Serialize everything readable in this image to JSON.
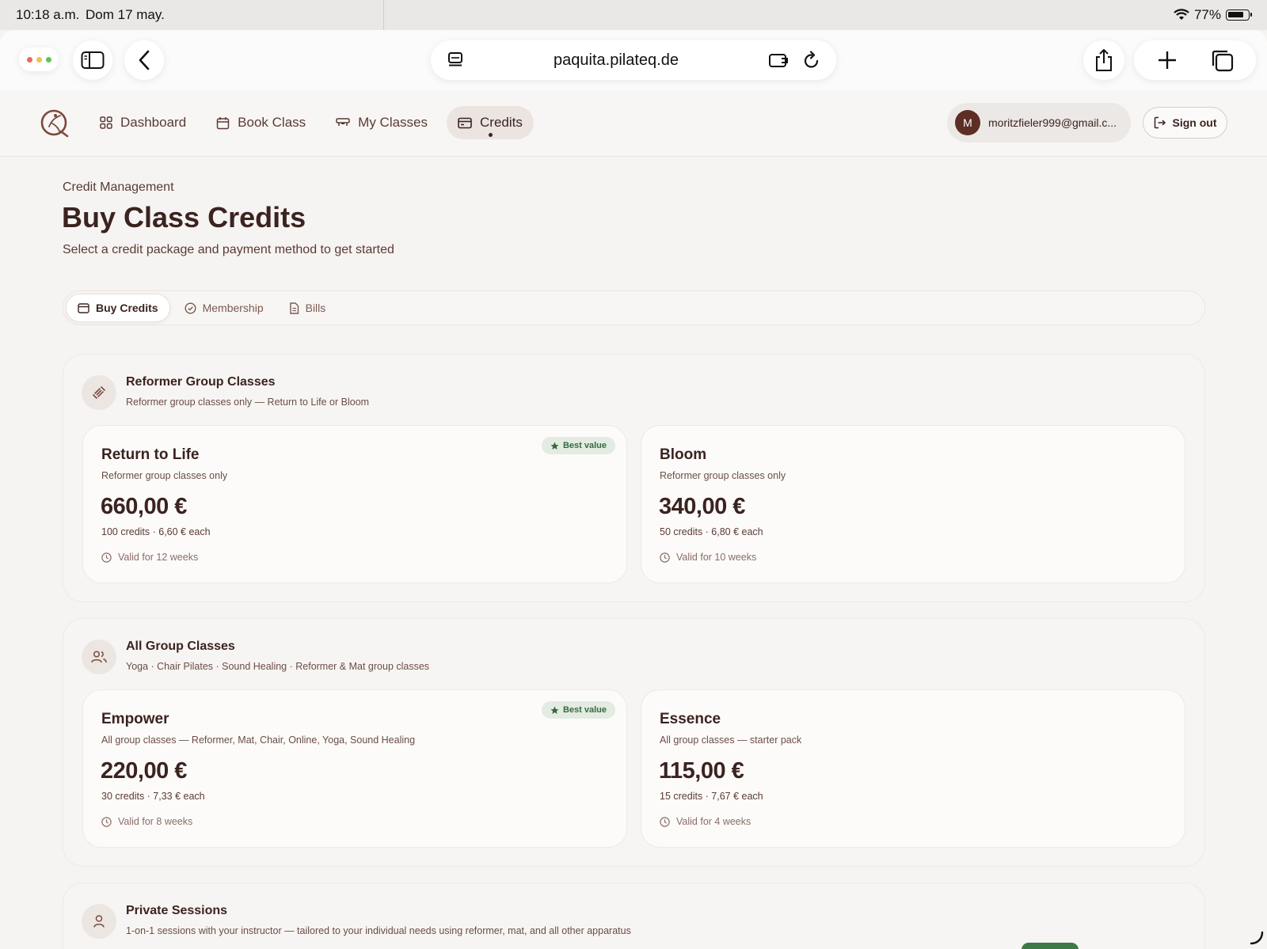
{
  "status_bar": {
    "time": "10:18 a.m.",
    "date": "Dom 17 may.",
    "battery": "77%"
  },
  "browser": {
    "url": "paquita.pilateq.de"
  },
  "nav": {
    "items": [
      {
        "label": "Dashboard",
        "icon": "grid-icon"
      },
      {
        "label": "Book Class",
        "icon": "calendar-icon"
      },
      {
        "label": "My Classes",
        "icon": "reformer-icon"
      },
      {
        "label": "Credits",
        "icon": "card-icon",
        "active": true
      }
    ],
    "user_initial": "M",
    "user_email": "moritzfieler999@gmail.c...",
    "signout_label": "Sign out"
  },
  "page": {
    "eyebrow": "Credit Management",
    "title": "Buy Class Credits",
    "subtitle": "Select a credit package and payment method to get started"
  },
  "tabs": [
    {
      "label": "Buy Credits",
      "active": true
    },
    {
      "label": "Membership"
    },
    {
      "label": "Bills"
    }
  ],
  "sections": [
    {
      "title": "Reformer Group Classes",
      "description": "Reformer group classes only — Return to Life or Bloom",
      "packages": [
        {
          "name": "Return to Life",
          "description": "Reformer group classes only",
          "price": "660,00 €",
          "credits": "100 credits · 6,60 € each",
          "validity": "Valid for 12 weeks",
          "badge": "Best value"
        },
        {
          "name": "Bloom",
          "description": "Reformer group classes only",
          "price": "340,00 €",
          "credits": "50 credits · 6,80 € each",
          "validity": "Valid for 10 weeks"
        }
      ]
    },
    {
      "title": "All Group Classes",
      "description": "Yoga · Chair Pilates · Sound Healing · Reformer & Mat group classes",
      "packages": [
        {
          "name": "Empower",
          "description": "All group classes — Reformer, Mat, Chair, Online, Yoga, Sound Healing",
          "price": "220,00 €",
          "credits": "30 credits · 7,33 € each",
          "validity": "Valid for 8 weeks",
          "badge": "Best value"
        },
        {
          "name": "Essence",
          "description": "All group classes — starter pack",
          "price": "115,00 €",
          "credits": "15 credits · 7,67 € each",
          "validity": "Valid for 4 weeks"
        }
      ]
    },
    {
      "title": "Private Sessions",
      "description": "1-on-1 sessions with your instructor — tailored to your individual needs using reformer, mat, and all other apparatus"
    }
  ],
  "colors": {
    "brand": "#3b2320",
    "badge_green": "#356b3d",
    "avatar": "#5d2e25"
  }
}
